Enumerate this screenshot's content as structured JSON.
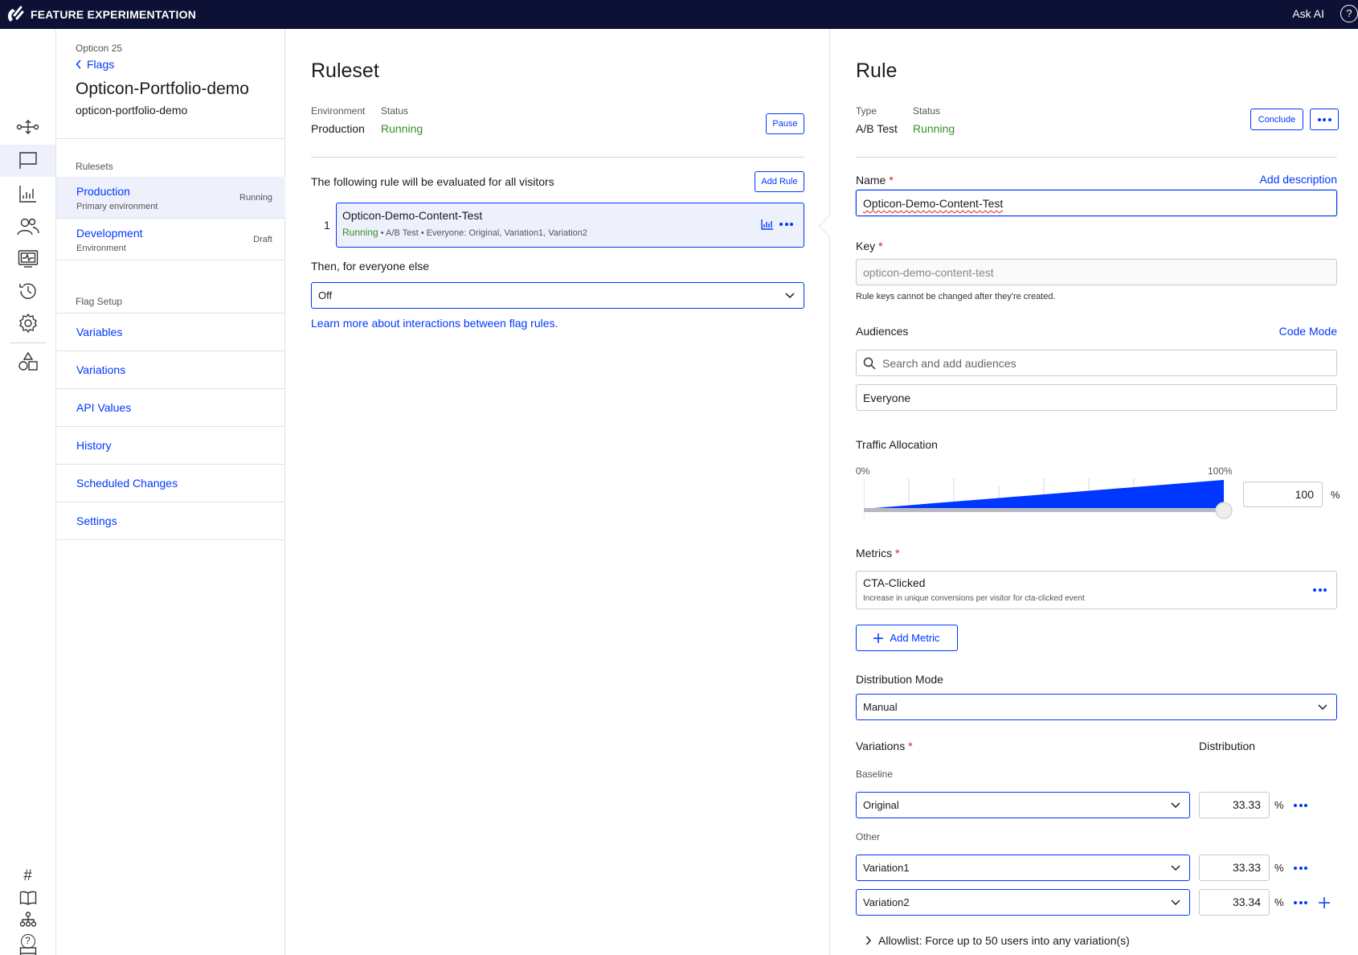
{
  "topbar": {
    "app_title": "FEATURE EXPERIMENTATION",
    "ask_ai": "Ask AI",
    "help_glyph": "?"
  },
  "rail": {
    "items": [
      "flows-icon",
      "flag-icon",
      "reports-icon",
      "audiences-icon",
      "events-icon",
      "history-icon",
      "settings-icon",
      "shapes-icon",
      "hash-icon",
      "book-icon",
      "hierarchy-icon",
      "help-icon",
      "monitor-icon"
    ],
    "hash_glyph": "#",
    "help_glyph": "?"
  },
  "nav": {
    "project": "Opticon 25",
    "back_label": "Flags",
    "flag_name": "Opticon-Portfolio-demo",
    "flag_key": "opticon-portfolio-demo",
    "rulesets_label": "Rulesets",
    "rulesets": [
      {
        "name": "Production",
        "sub": "Primary environment",
        "status": "Running"
      },
      {
        "name": "Development",
        "sub": "Environment",
        "status": "Draft"
      }
    ],
    "flag_setup_label": "Flag Setup",
    "setup_links": [
      "Variables",
      "Variations",
      "API Values",
      "History",
      "Scheduled Changes",
      "Settings"
    ]
  },
  "ruleset": {
    "title": "Ruleset",
    "env_label": "Environment",
    "env_value": "Production",
    "status_label": "Status",
    "status_value": "Running",
    "pause_label": "Pause",
    "evaluated_text": "The following rule will be evaluated for all visitors",
    "add_rule_label": "Add Rule",
    "rule": {
      "index": "1",
      "name": "Opticon-Demo-Content-Test",
      "status": "Running",
      "meta": " • A/B Test • Everyone: Original, Variation1, Variation2"
    },
    "then_text": "Then, for everyone else",
    "fallback_value": "Off",
    "learn_more": "Learn more about interactions between flag rules."
  },
  "rule": {
    "title": "Rule",
    "type_label": "Type",
    "type_value": "A/B Test",
    "status_label": "Status",
    "status_value": "Running",
    "conclude_label": "Conclude",
    "name_label": "Name",
    "required_mark": "*",
    "add_description": "Add description",
    "name_value": "Opticon-Demo-Content-Test",
    "key_label": "Key",
    "key_placeholder": "opticon-demo-content-test",
    "key_hint": "Rule keys cannot be changed after they're created.",
    "audiences_label": "Audiences",
    "code_mode": "Code Mode",
    "audience_search_placeholder": "Search and add audiences",
    "audience_value": "Everyone",
    "traffic_label": "Traffic Allocation",
    "traffic_min": "0%",
    "traffic_max": "100%",
    "traffic_value": "100",
    "traffic_fraction": 1.0,
    "pct_sign": "%",
    "metrics_label": "Metrics",
    "metric_name": "CTA-Clicked",
    "metric_desc": "Increase in unique conversions per visitor for cta-clicked event",
    "add_metric": "Add Metric",
    "distribution_mode_label": "Distribution Mode",
    "distribution_mode_value": "Manual",
    "variations_label": "Variations",
    "distribution_label": "Distribution",
    "baseline_label": "Baseline",
    "other_label": "Other",
    "variations": [
      {
        "name": "Original",
        "value": "33.33"
      },
      {
        "name": "Variation1",
        "value": "33.33"
      },
      {
        "name": "Variation2",
        "value": "33.34"
      }
    ],
    "allowlist": "Allowlist: Force up to 50 users into any variation(s)"
  },
  "colors": {
    "accent": "#0037ff",
    "running": "#3a8c2c",
    "topbar": "#0d1135",
    "required": "#d21f1f"
  }
}
